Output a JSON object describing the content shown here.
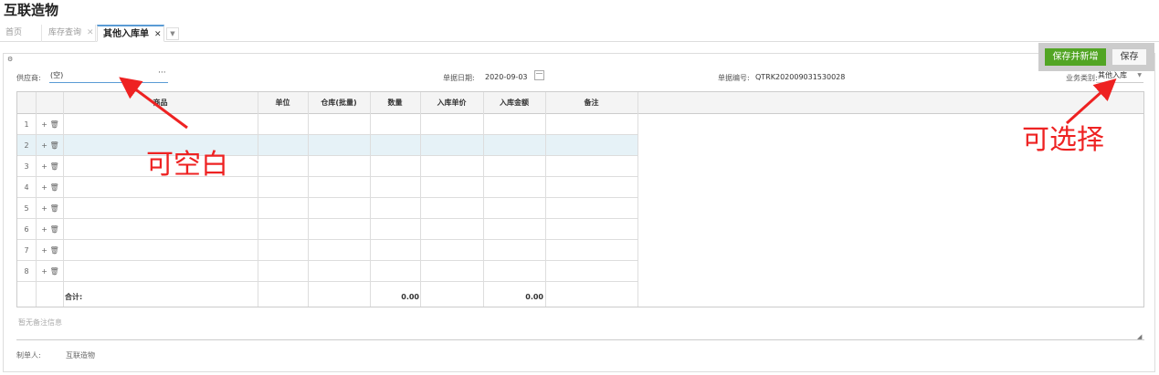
{
  "app_title": "互联造物",
  "tabs": [
    {
      "label": "首页",
      "closable": false
    },
    {
      "label": "库存查询",
      "closable": true
    },
    {
      "label": "其他入库单",
      "closable": true,
      "active": true
    }
  ],
  "actions": {
    "save_new_label": "保存并新增",
    "save_label": "保存"
  },
  "form": {
    "supplier_label": "供应商:",
    "supplier_value": "(空)",
    "supplier_more": "···",
    "date_label": "单据日期:",
    "date_value": "2020-09-03",
    "no_label": "单据编号:",
    "no_value": "QTRK202009031530028",
    "type_label": "业务类别:",
    "type_value": "其他入库"
  },
  "grid": {
    "columns": [
      "商品",
      "单位",
      "仓库(批量)",
      "数量",
      "入库单价",
      "入库金额",
      "备注"
    ],
    "rows": [
      {
        "num": "1",
        "actions": "+ 🗑"
      },
      {
        "num": "2",
        "actions": "+ 🗑"
      },
      {
        "num": "3",
        "actions": "+ 🗑"
      },
      {
        "num": "4",
        "actions": "+ 🗑"
      },
      {
        "num": "5",
        "actions": "+ 🗑"
      },
      {
        "num": "6",
        "actions": "+ 🗑"
      },
      {
        "num": "7",
        "actions": "+ 🗑"
      },
      {
        "num": "8",
        "actions": "+ 🗑"
      }
    ],
    "total_label": "合计:",
    "total_qty": "0.00",
    "total_amount": "0.00"
  },
  "remark_placeholder": "暂无备注信息",
  "maker_label": "制单人:",
  "maker_value": "互联造物",
  "annotations": {
    "blank_ok": "可空白",
    "selectable": "可选择"
  },
  "colors": {
    "accent": "#52a524",
    "annotation": "#ee2222",
    "selected_row": "#e6f2f7"
  }
}
